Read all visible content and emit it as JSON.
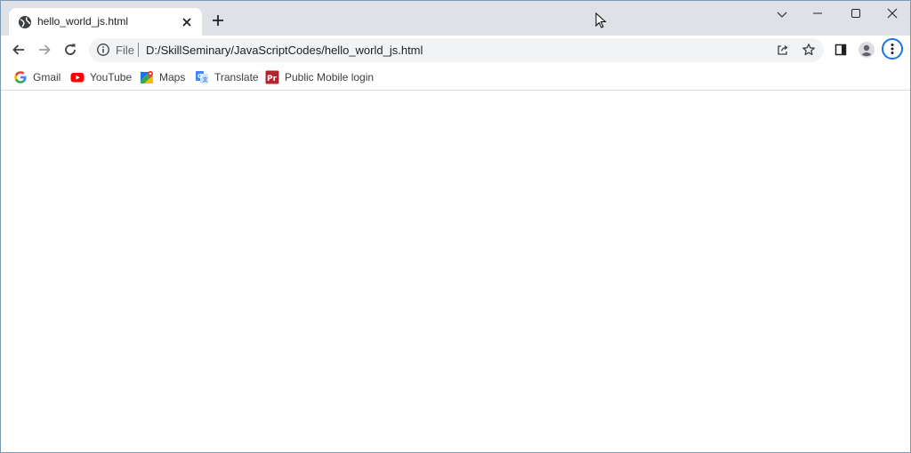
{
  "tab": {
    "title": "hello_world_js.html",
    "favicon": "globe-icon"
  },
  "toolbar": {
    "scheme_label": "File",
    "url": "D:/SkillSeminary/JavaScriptCodes/hello_world_js.html"
  },
  "bookmarks": [
    {
      "label": "Gmail",
      "icon": "google-icon"
    },
    {
      "label": "YouTube",
      "icon": "youtube-icon"
    },
    {
      "label": "Maps",
      "icon": "maps-icon"
    },
    {
      "label": "Translate",
      "icon": "translate-icon"
    },
    {
      "label": "Public Mobile login",
      "icon": "pm-icon"
    }
  ],
  "colors": {
    "tabstrip": "#dee1e6",
    "omnibox": "#f1f3f4",
    "accent": "#1a73e8"
  }
}
